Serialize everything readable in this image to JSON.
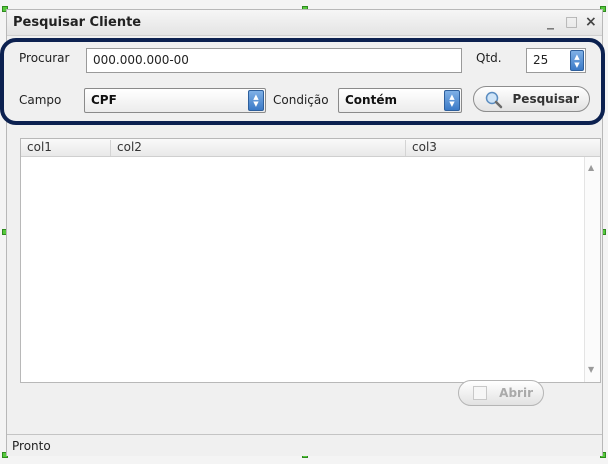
{
  "window": {
    "title": "Pesquisar Cliente",
    "controls": {
      "minimize": "_",
      "maximize": "□",
      "close": "×"
    }
  },
  "search": {
    "procurar_label": "Procurar",
    "procurar_value": "000.000.000-00",
    "qtd_label": "Qtd.",
    "qtd_value": "25",
    "campo_label": "Campo",
    "campo_value": "CPF",
    "condicao_label": "Condição",
    "condicao_value": "Contém",
    "pesquisar_label": "Pesquisar",
    "pesquisar_icon": "magnifier-icon"
  },
  "grid": {
    "columns": [
      "col1",
      "col2",
      "col3"
    ]
  },
  "actions": {
    "abrir_label": "Abrir"
  },
  "status": {
    "text": "Pronto"
  },
  "colors": {
    "highlight_border": "#0c2150",
    "handle": "#55c93b",
    "spin_accent": "#3b7ac7"
  }
}
